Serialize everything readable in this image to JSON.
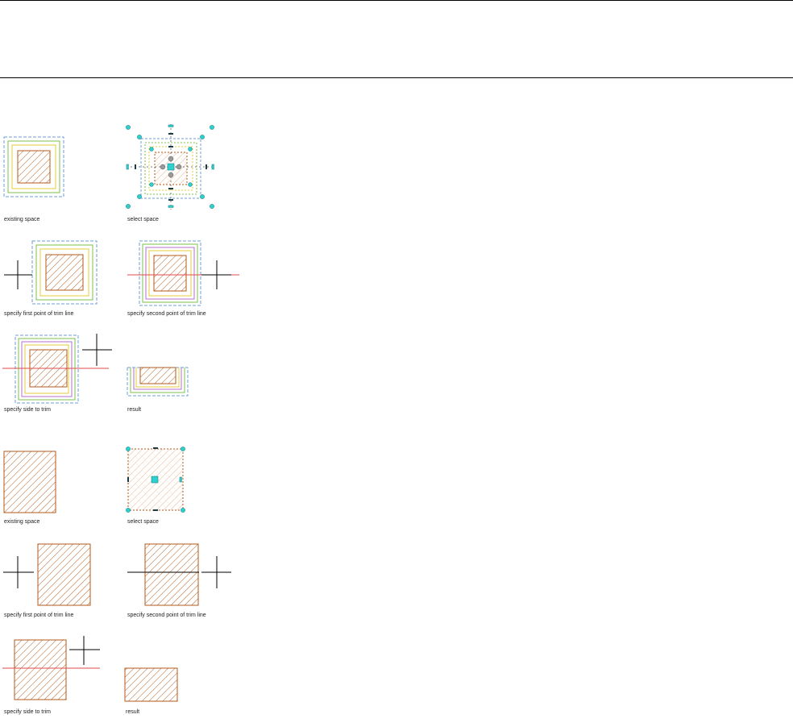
{
  "panels": [
    {
      "caption": "existing space"
    },
    {
      "caption": "select space"
    },
    {
      "caption": "specify first point of trim line"
    },
    {
      "caption": "specify second point of trim line"
    },
    {
      "caption": "specify side to trim"
    },
    {
      "caption": "result"
    },
    {
      "caption": "existing space"
    },
    {
      "caption": "select space"
    },
    {
      "caption": "specify first point of trim line"
    },
    {
      "caption": "specify second point of trim line"
    },
    {
      "caption": "specify side to trim"
    },
    {
      "caption": "result"
    }
  ],
  "colors": {
    "hatch": "#b05a1a",
    "dash_blue": "#6f9ed6",
    "green": "#7cc24a",
    "yellow": "#e3cc3a",
    "magenta": "#b66fc9",
    "trim_line": "#e24b4b",
    "grip": "#2fd0d0",
    "crosshair": "#000000"
  }
}
